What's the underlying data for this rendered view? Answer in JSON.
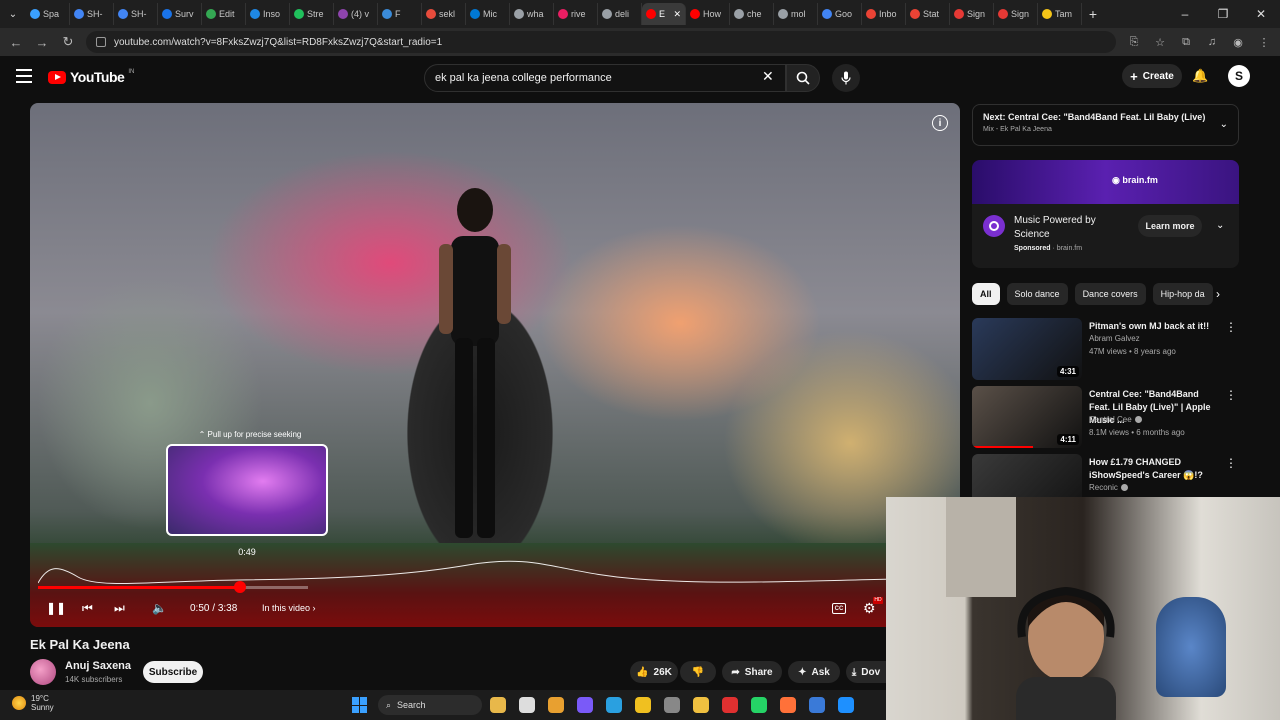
{
  "browser": {
    "tabs": [
      {
        "label": "Spa",
        "color": "#3aa0ff"
      },
      {
        "label": "SH-",
        "color": "#4285f4"
      },
      {
        "label": "SH-",
        "color": "#4285f4"
      },
      {
        "label": "Surv",
        "color": "#1a73e8"
      },
      {
        "label": "Edit",
        "color": "#34a853"
      },
      {
        "label": "Inso",
        "color": "#1e88e5"
      },
      {
        "label": "Stre",
        "color": "#20c05c"
      },
      {
        "label": "(4) v",
        "color": "#8e44ad"
      },
      {
        "label": "F",
        "color": "#3b8bd8"
      },
      {
        "label": "sekl",
        "color": "#e74c3c"
      },
      {
        "label": "Mic",
        "color": "#0078d4"
      },
      {
        "label": "wha",
        "color": "#9aa0a6"
      },
      {
        "label": "rive",
        "color": "#e91e63"
      },
      {
        "label": "deli",
        "color": "#9aa0a6"
      },
      {
        "label": "E",
        "color": "#ff0000"
      },
      {
        "label": "How",
        "color": "#ff0000"
      },
      {
        "label": "che",
        "color": "#9aa0a6"
      },
      {
        "label": "mol",
        "color": "#9aa0a6"
      },
      {
        "label": "Goo",
        "color": "#4285f4"
      },
      {
        "label": "Inbo",
        "color": "#ea4335"
      },
      {
        "label": "Stat",
        "color": "#ea4335"
      },
      {
        "label": "Sign",
        "color": "#e53935"
      },
      {
        "label": "Sign",
        "color": "#e53935"
      },
      {
        "label": "Tam",
        "color": "#f5c518"
      }
    ],
    "active_tab_index": 14,
    "new_tab": "+",
    "url": "youtube.com/watch?v=8FxksZwzj7Q&list=RD8FxksZwzj7Q&start_radio=1"
  },
  "header": {
    "logo_word": "YouTube",
    "logo_country": "IN",
    "search_value": "ek pal ka jeena college performance",
    "create_label": "Create",
    "avatar_letter": "S"
  },
  "player": {
    "preview_hint": "Pull up for precise seeking",
    "preview_time": "0:49",
    "progress_fraction": 0.235,
    "time_current": "0:50",
    "time_total": "3:38",
    "time_separator": " / ",
    "in_this_video": "In this video",
    "cc_label": "CC",
    "hd_label": "HD",
    "info_label": "i"
  },
  "video": {
    "title": "Ek Pal Ka Jeena",
    "channel": "Anuj Saxena",
    "subscribers": "14K subscribers",
    "subscribe_label": "Subscribe",
    "likes": "26K",
    "share_label": "Share",
    "ask_label": "Ask",
    "download_label": "Dov"
  },
  "sidebar": {
    "next_title": "Next: Central Cee: \"Band4Band Feat. Lil Baby (Live)\"...",
    "next_sub": "Mix - Ek Pal Ka Jeena",
    "ad": {
      "brand": "brain.fm",
      "title": "Music Powered by Science",
      "sponsored_label": "Sponsored",
      "sponsored_domain": "brain.fm",
      "learn_more": "Learn more"
    },
    "chips": [
      "All",
      "Solo dance",
      "Dance covers",
      "Hip-hop da"
    ],
    "recommendations": [
      {
        "title": "Pitman's own MJ back at it!!",
        "channel": "Abram Galvez",
        "meta": "47M views • 8 years ago",
        "duration": "4:31",
        "watched_fraction": 0,
        "verified": false,
        "thumb_color": "#2a3a5a"
      },
      {
        "title": "Central Cee: \"Band4Band Feat. Lil Baby (Live)\" | Apple Music ...",
        "channel": "Central Cee",
        "meta": "8.1M views • 6 months ago",
        "duration": "4:11",
        "watched_fraction": 0.55,
        "verified": true,
        "thumb_color": "#5a5048"
      },
      {
        "title": "How £1.79 CHANGED iShowSpeed's Career 😱!?",
        "channel": "Reconic",
        "meta": "",
        "duration": "",
        "watched_fraction": 0,
        "verified": true,
        "thumb_color": "#3a3a3a"
      }
    ]
  },
  "taskbar": {
    "weather_temp": "19°C",
    "weather_cond": "Sunny",
    "search_label": "Search",
    "apps": [
      "#e8b84a",
      "#dddddd",
      "#e8a030",
      "#7a5af8",
      "#2aa0e0",
      "#f0c020",
      "#888888",
      "#f0c040",
      "#e03030",
      "#25d366",
      "#ff7139",
      "#3a7ad8",
      "#1e90ff"
    ]
  },
  "colors": {
    "accent": "#ff0000",
    "background": "#0f0f0f"
  }
}
